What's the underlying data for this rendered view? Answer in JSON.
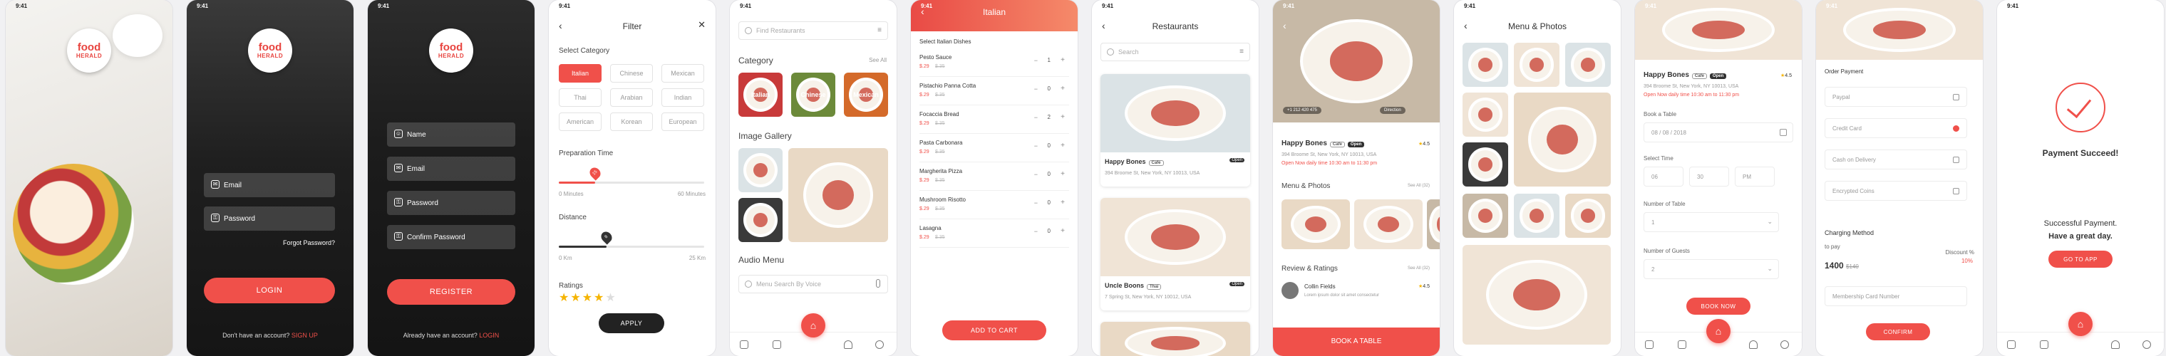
{
  "status": {
    "time": "9:41"
  },
  "brand": {
    "line1": "food",
    "line2": "HERALD"
  },
  "login": {
    "email": "Email",
    "password": "Password",
    "forgot": "Forgot Password?",
    "button": "LOGIN",
    "no_account": "Don't have an account?",
    "signup": "SIGN UP"
  },
  "register": {
    "name": "Name",
    "email": "Email",
    "password": "Password",
    "confirm": "Confirm Password",
    "button": "REGISTER",
    "have_account": "Already have an account?",
    "login": "LOGIN"
  },
  "filter": {
    "title": "Filter",
    "category_label": "Select Category",
    "categories": [
      "Italian",
      "Chinese",
      "Mexican",
      "Thai",
      "Arabian",
      "Indian",
      "American",
      "Korean",
      "European"
    ],
    "prep_label": "Preparation Time",
    "prep_value": "15",
    "prep_min": "0 Minutes",
    "prep_max": "60 Minutes",
    "prep_fraction": 0.25,
    "distance_label": "Distance",
    "distance_value": "8",
    "distance_min": "0 Km",
    "distance_max": "25 Km",
    "distance_fraction": 0.33,
    "ratings_label": "Ratings",
    "stars": "★★★★",
    "star_empty": "★",
    "button": "APPLY"
  },
  "home": {
    "search": "Find Restaurants",
    "category_title": "Category",
    "category_more": "See All",
    "categories": [
      "Italian",
      "Chinese",
      "Mexican"
    ],
    "gallery_title": "Image Gallery",
    "audio_title": "Audio Menu",
    "audio_search": "Menu Search By Voice"
  },
  "italian": {
    "title": "Italian",
    "subtitle": "Select Italian Dishes",
    "dishes": [
      {
        "name": "Pesto Sauce",
        "price": "$.29",
        "old": "$.35",
        "qty": "1"
      },
      {
        "name": "Pistachio Panna Cotta",
        "price": "$.29",
        "old": "$.35",
        "qty": "0"
      },
      {
        "name": "Focaccia Bread",
        "price": "$.29",
        "old": "$.35",
        "qty": "2"
      },
      {
        "name": "Pasta Carbonara",
        "price": "$.29",
        "old": "$.35",
        "qty": "0"
      },
      {
        "name": "Margherita Pizza",
        "price": "$.29",
        "old": "$.35",
        "qty": "0"
      },
      {
        "name": "Mushroom Risotto",
        "price": "$.29",
        "old": "$.35",
        "qty": "0"
      },
      {
        "name": "Lasagna",
        "price": "$.29",
        "old": "$.35",
        "qty": "0"
      }
    ],
    "button": "ADD TO CART"
  },
  "restaurants": {
    "title": "Restaurants",
    "search": "Search",
    "items": [
      {
        "name": "Happy Bones",
        "addr": "394 Broome St, New York, NY 10013, USA",
        "tag1": "Cafe",
        "tag2": "Open",
        "rating": "4.5"
      },
      {
        "name": "Uncle Boons",
        "addr": "7 Spring St, New York, NY 10012, USA",
        "tag1": "Thai",
        "tag2": "Open",
        "rating": "4.5"
      }
    ]
  },
  "detail": {
    "name": "Happy Bones",
    "tag1": "Cafe",
    "tag2": "Open",
    "rating": "4.5",
    "addr": "394 Broome St, New York, NY 10013, USA",
    "hours": "Open Now",
    "hours_detail": "daily time 10:30 am to 11:30 pm",
    "phone": "+1 212 420 475",
    "direction": "Direction",
    "menu_title": "Menu & Photos",
    "menu_more": "See All (32)",
    "reviews_title": "Review & Ratings",
    "reviews_more": "See All (32)",
    "reviewer": "Collin Fields",
    "review": "Lorem ipsum dolor sit amet consectetur",
    "review_rating": "4.5",
    "button": "BOOK A TABLE"
  },
  "menu": {
    "title": "Menu & Photos"
  },
  "booking": {
    "name": "Happy Bones",
    "tag1": "Cafe",
    "tag2": "Open",
    "rating": "4.5",
    "addr": "394 Broome St, New York, NY 10013, USA",
    "hours": "Open Now",
    "hours_detail": "daily time 10:30 am to 11:30 pm",
    "date_label": "Book a Table",
    "date": "08 / 08 / 2018",
    "time_label": "Select Time",
    "hh": "06",
    "mm": "30",
    "ampm": "PM",
    "table_label": "Number of Table",
    "table_val": "1",
    "guests_label": "Number of Guests",
    "guests_val": "2",
    "button": "BOOK NOW"
  },
  "payment": {
    "title": "Order Payment",
    "options": [
      "Paypal",
      "Credit Card",
      "Cash on Delivery",
      "Encrypted Coins"
    ],
    "selected": 1,
    "charging": "Charging Method",
    "to_pay": "to pay",
    "amount": "1400",
    "old_amount": "$140",
    "discount_label": "Discount %",
    "discount": "10%",
    "membership": "Membership Card Number",
    "button": "CONFIRM"
  },
  "success": {
    "title": "Payment Succeed!",
    "line1": "Successful Payment.",
    "line2": "Have a great day.",
    "button": "GO TO APP"
  },
  "colors": {
    "accent": "#f0504a",
    "dark": "#1c1c1e"
  }
}
